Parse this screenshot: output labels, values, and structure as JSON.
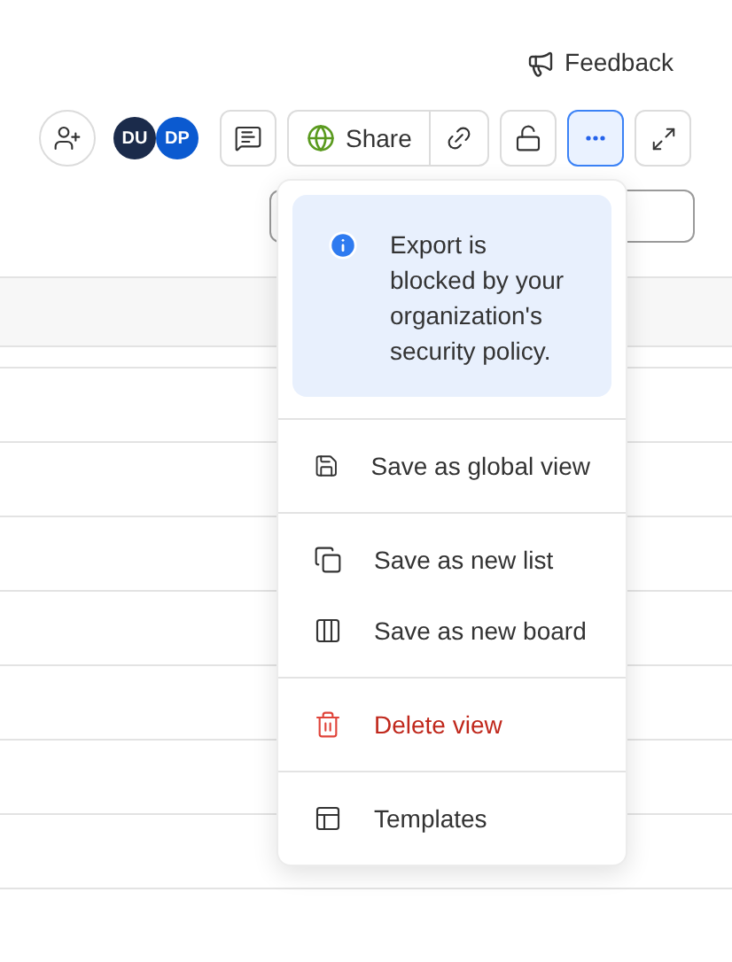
{
  "feedback": {
    "label": "Feedback"
  },
  "avatars": [
    {
      "initials": "DU",
      "color": "#1b2b4b"
    },
    {
      "initials": "DP",
      "color": "#0b5ad0"
    }
  ],
  "share_button": {
    "label": "Share"
  },
  "more_button": {
    "active": true
  },
  "menu": {
    "notice": "Export is blocked by your organization's security policy.",
    "groups": [
      [
        {
          "label": "Save as global view",
          "kind": "action"
        }
      ],
      [
        {
          "label": "Save as new list",
          "kind": "action"
        },
        {
          "label": "Save as new board",
          "kind": "action"
        }
      ],
      [
        {
          "label": "Delete view",
          "kind": "danger"
        }
      ],
      [
        {
          "label": "Templates",
          "kind": "action"
        }
      ]
    ]
  }
}
